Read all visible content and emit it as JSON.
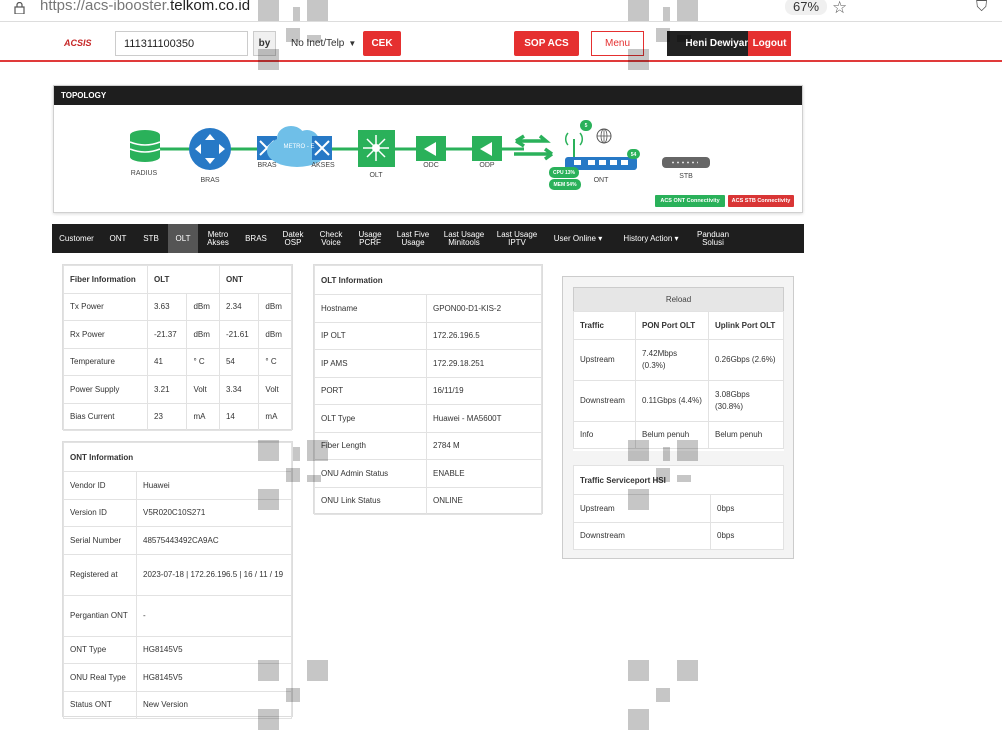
{
  "browser": {
    "url_prefix": "https://acs-ibooster.",
    "url_domain": "telkom.co.id",
    "zoom": "67%"
  },
  "header": {
    "logo": "ACSIS",
    "search_value": "111311100350",
    "by_label": "by",
    "select_value": "No Inet/Telp",
    "cek_label": "CEK",
    "sop_label": "SOP ACS",
    "menu_label": "Menu",
    "user_name": "Heni Dewiyanti",
    "logout_label": "Logout"
  },
  "topology": {
    "title": "TOPOLOGY",
    "nodes": {
      "radius": "RADIUS",
      "bras": "BRAS",
      "bras2": "BRAS",
      "metro": "METRO - E",
      "akses": "AKSES",
      "olt": "OLT",
      "odc": "ODC",
      "odp": "ODP",
      "ont": "ONT",
      "stb": "STB"
    },
    "ont_cpu": "CPU 13%",
    "ont_mem": "MEM 54%",
    "ont_badge_top": "5",
    "ont_badge_right": "54",
    "acs_ont": "ACS ONT Connectivity",
    "acs_stb": "ACS STB Connectivity",
    "colors": {
      "green": "#2ab15a",
      "blue": "#2779c6",
      "red": "#d93535"
    }
  },
  "tabs": [
    {
      "label": "Customer"
    },
    {
      "label": "ONT"
    },
    {
      "label": "STB"
    },
    {
      "label": "OLT"
    },
    {
      "label": "Metro\nAkses"
    },
    {
      "label": "BRAS"
    },
    {
      "label": "Datek\nOSP"
    },
    {
      "label": "Check\nVoice"
    },
    {
      "label": "Usage\nPCRF"
    },
    {
      "label": "Last Five\nUsage"
    },
    {
      "label": "Last Usage\nMinitools"
    },
    {
      "label": "Last Usage\nIPTV"
    },
    {
      "label": "User Online ▾"
    },
    {
      "label": "History Action ▾"
    },
    {
      "label": "Panduan\nSolusi"
    }
  ],
  "fiber": {
    "headers": [
      "Fiber Information",
      "OLT",
      "ONT"
    ],
    "rows": [
      [
        "Tx Power",
        "3.63",
        "dBm",
        "2.34",
        "dBm"
      ],
      [
        "Rx Power",
        "-21.37",
        "dBm",
        "-21.61",
        "dBm"
      ],
      [
        "Temperature",
        "41",
        "° C",
        "54",
        "° C"
      ],
      [
        "Power Supply",
        "3.21",
        "Volt",
        "3.34",
        "Volt"
      ],
      [
        "Bias Current",
        "23",
        "mA",
        "14",
        "mA"
      ]
    ]
  },
  "ont_info": {
    "title": "ONT Information",
    "rows": [
      [
        "Vendor ID",
        "Huawei"
      ],
      [
        "Version ID",
        "V5R020C10S271"
      ],
      [
        "Serial Number",
        "48575443492CA9AC"
      ],
      [
        "Registered at",
        "2023-07-18 | 172.26.196.5 | 16 / 11 / 19"
      ],
      [
        "Pergantian ONT",
        "-"
      ],
      [
        "ONT Type",
        "HG8145V5"
      ],
      [
        "ONU Real Type",
        "HG8145V5"
      ],
      [
        "Status ONT",
        "New Version"
      ]
    ]
  },
  "olt_info": {
    "title": "OLT Information",
    "rows": [
      [
        "Hostname",
        "GPON00-D1-KIS-2"
      ],
      [
        "IP OLT",
        "172.26.196.5"
      ],
      [
        "IP AMS",
        "172.29.18.251"
      ],
      [
        "PORT",
        "16/11/19"
      ],
      [
        "OLT Type",
        "Huawei - MA5600T"
      ],
      [
        "Fiber Length",
        "2784 M"
      ],
      [
        "ONU Admin Status",
        "ENABLE"
      ],
      [
        "ONU Link Status",
        "ONLINE"
      ]
    ]
  },
  "traffic": {
    "reload": "Reload",
    "headers": [
      "Traffic",
      "PON Port OLT",
      "Uplink Port OLT"
    ],
    "rows": [
      [
        "Upstream",
        "7.42Mbps (0.3%)",
        "0.26Gbps (2.6%)"
      ],
      [
        "Downstream",
        "0.11Gbps (4.4%)",
        "3.08Gbps (30.8%)"
      ],
      [
        "Info",
        "Belum penuh",
        "Belum penuh"
      ]
    ],
    "hsi_title": "Traffic Serviceport HSI",
    "hsi_rows": [
      [
        "Upstream",
        "0bps"
      ],
      [
        "Downstream",
        "0bps"
      ]
    ]
  }
}
